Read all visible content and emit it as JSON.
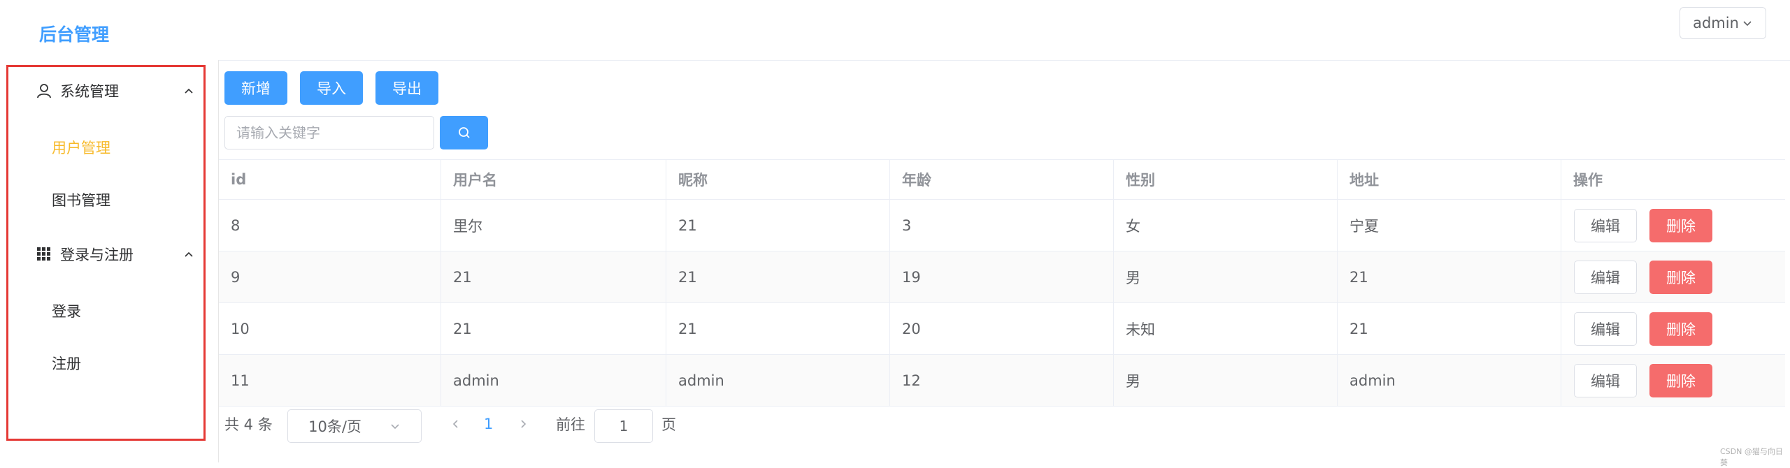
{
  "header": {
    "brand": "后台管理",
    "user_label": "admin"
  },
  "sidebar": {
    "groups": [
      {
        "title": "系统管理",
        "icon": "user-icon",
        "items": [
          "用户管理",
          "图书管理"
        ]
      },
      {
        "title": "登录与注册",
        "icon": "grid-icon",
        "items": [
          "登录",
          "注册"
        ]
      }
    ],
    "active_item": "用户管理"
  },
  "toolbar": {
    "add_label": "新增",
    "import_label": "导入",
    "export_label": "导出"
  },
  "search": {
    "placeholder": "请输入关键字",
    "button_icon": "search-icon"
  },
  "table": {
    "columns": [
      "id",
      "用户名",
      "昵称",
      "年龄",
      "性别",
      "地址",
      "操作"
    ],
    "rows": [
      [
        "8",
        "里尔",
        "21",
        "3",
        "女",
        "宁夏"
      ],
      [
        "9",
        "21",
        "21",
        "19",
        "男",
        "21"
      ],
      [
        "10",
        "21",
        "21",
        "20",
        "未知",
        "21"
      ],
      [
        "11",
        "admin",
        "admin",
        "12",
        "男",
        "admin"
      ]
    ],
    "edit_label": "编辑",
    "delete_label": "删除"
  },
  "pagination": {
    "total_text": "共 4 条",
    "page_size": "10条/页",
    "current_page": "1",
    "goto_label": "前往",
    "goto_value": "1",
    "page_suffix": "页"
  },
  "colors": {
    "primary": "#409eff",
    "danger": "#f56c6c",
    "active_menu": "#f7ba2a",
    "sidebar_border": "#e53935"
  },
  "watermark": "CSDN @猫与向日葵"
}
